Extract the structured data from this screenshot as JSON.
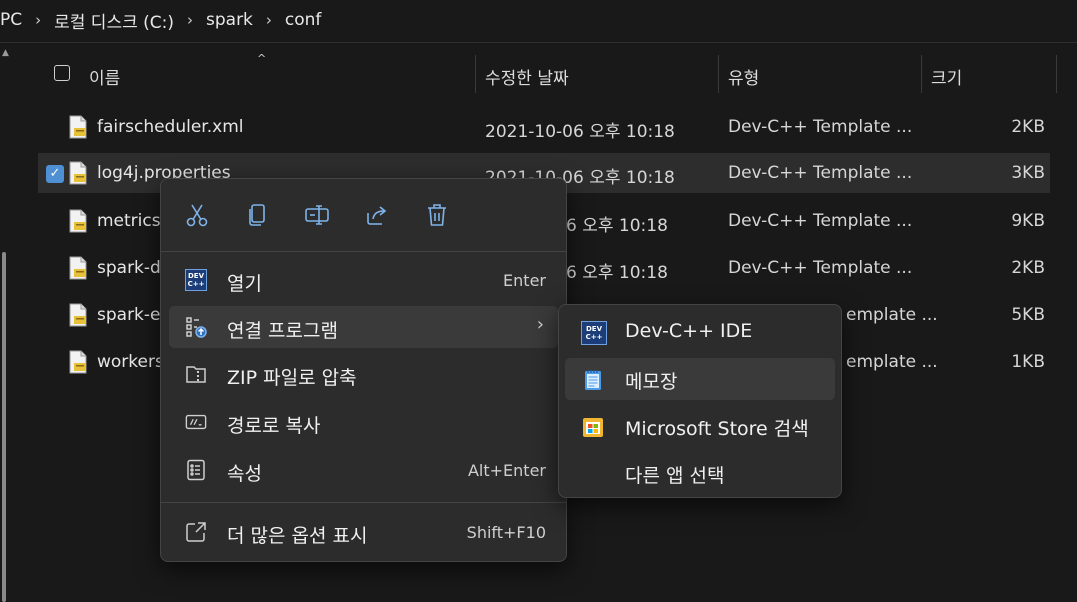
{
  "breadcrumb": {
    "items": [
      "PC",
      "로컬 디스크 (C:)",
      "spark",
      "conf"
    ],
    "separator": "›"
  },
  "columns": {
    "name": "이름",
    "modified": "수정한 날짜",
    "type": "유형",
    "size": "크기"
  },
  "files": [
    {
      "name": "fairscheduler.xml",
      "modified": "2021-10-06 오후 10:18",
      "type": "Dev-C++ Template ...",
      "size": "2KB",
      "selected": false
    },
    {
      "name": "log4j.properties",
      "modified": "2021-10-06 오후 10:18",
      "type": "Dev-C++ Template ...",
      "size": "3KB",
      "selected": true
    },
    {
      "name": "metrics.",
      "modified": "6 오후 10:18",
      "type": "Dev-C++ Template ...",
      "size": "9KB",
      "selected": false
    },
    {
      "name": "spark-d",
      "modified": "6 오후 10:18",
      "type": "Dev-C++ Template ...",
      "size": "2KB",
      "selected": false
    },
    {
      "name": "spark-e",
      "modified": "",
      "type": "emplate ...",
      "size": "5KB",
      "selected": false
    },
    {
      "name": "workers",
      "modified": "",
      "type": "emplate ...",
      "size": "1KB",
      "selected": false
    }
  ],
  "context_menu": {
    "quick_actions": [
      {
        "icon": "cut-icon"
      },
      {
        "icon": "copy-icon"
      },
      {
        "icon": "rename-icon"
      },
      {
        "icon": "share-icon"
      },
      {
        "icon": "delete-icon"
      }
    ],
    "items": [
      {
        "label": "열기",
        "shortcut": "Enter",
        "icon": "dev-cpp-icon"
      },
      {
        "label": "연결 프로그램",
        "shortcut": "",
        "icon": "open-with-icon",
        "has_submenu": true
      },
      {
        "label": "ZIP 파일로 압축",
        "shortcut": "",
        "icon": "zip-folder-icon"
      },
      {
        "label": "경로로 복사",
        "shortcut": "",
        "icon": "copy-path-icon"
      },
      {
        "label": "속성",
        "shortcut": "Alt+Enter",
        "icon": "properties-icon"
      },
      {
        "label": "더 많은 옵션 표시",
        "shortcut": "Shift+F10",
        "icon": "more-options-icon"
      }
    ],
    "submenu_arrow": "›"
  },
  "submenu": {
    "items": [
      {
        "label": "Dev-C++ IDE",
        "icon": "dev-cpp-icon"
      },
      {
        "label": "메모장",
        "icon": "notepad-icon"
      },
      {
        "label": "Microsoft Store 검색",
        "icon": "store-icon"
      },
      {
        "label": "다른 앱 선택",
        "icon": ""
      }
    ]
  },
  "colors": {
    "background": "#191919",
    "menu_background": "#2c2c2c",
    "accent": "#4f8fd3",
    "selected_row": "#2d2d2d"
  }
}
